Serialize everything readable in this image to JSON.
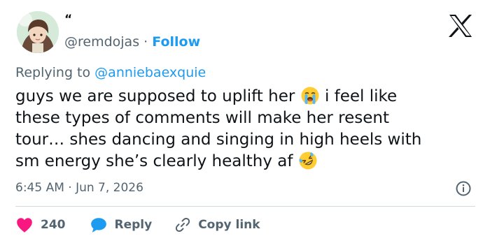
{
  "tweet": {
    "display_name": "“",
    "handle": "@remdojas",
    "separator": "·",
    "follow_label": "Follow",
    "replying_prefix": "Replying to",
    "replying_to": "@anniebaexquie",
    "lines": [
      "guys we are supposed to uplift her",
      "i feel like",
      "these types of comments will make her resent",
      "tour… shes dancing and singing in high heels with",
      "sm energy she’s clearly healthy af"
    ],
    "emojis": [
      "loudly-crying-face-icon",
      "rolling-on-floor-laughing-icon"
    ],
    "timestamp": "6:45 AM · Jun 7, 2026"
  },
  "actions": {
    "like_count": "240",
    "reply_label": "Reply",
    "copy_label": "Copy link"
  },
  "icons": {
    "brand": "x-logo-icon",
    "info": "info-icon",
    "like": "heart-icon",
    "reply": "speech-bubble-icon",
    "copy": "link-icon"
  },
  "colors": {
    "accent": "#1d9bf0",
    "like": "#f91880",
    "text": "#0f1419",
    "muted": "#536471",
    "divider": "#cfd9de"
  }
}
